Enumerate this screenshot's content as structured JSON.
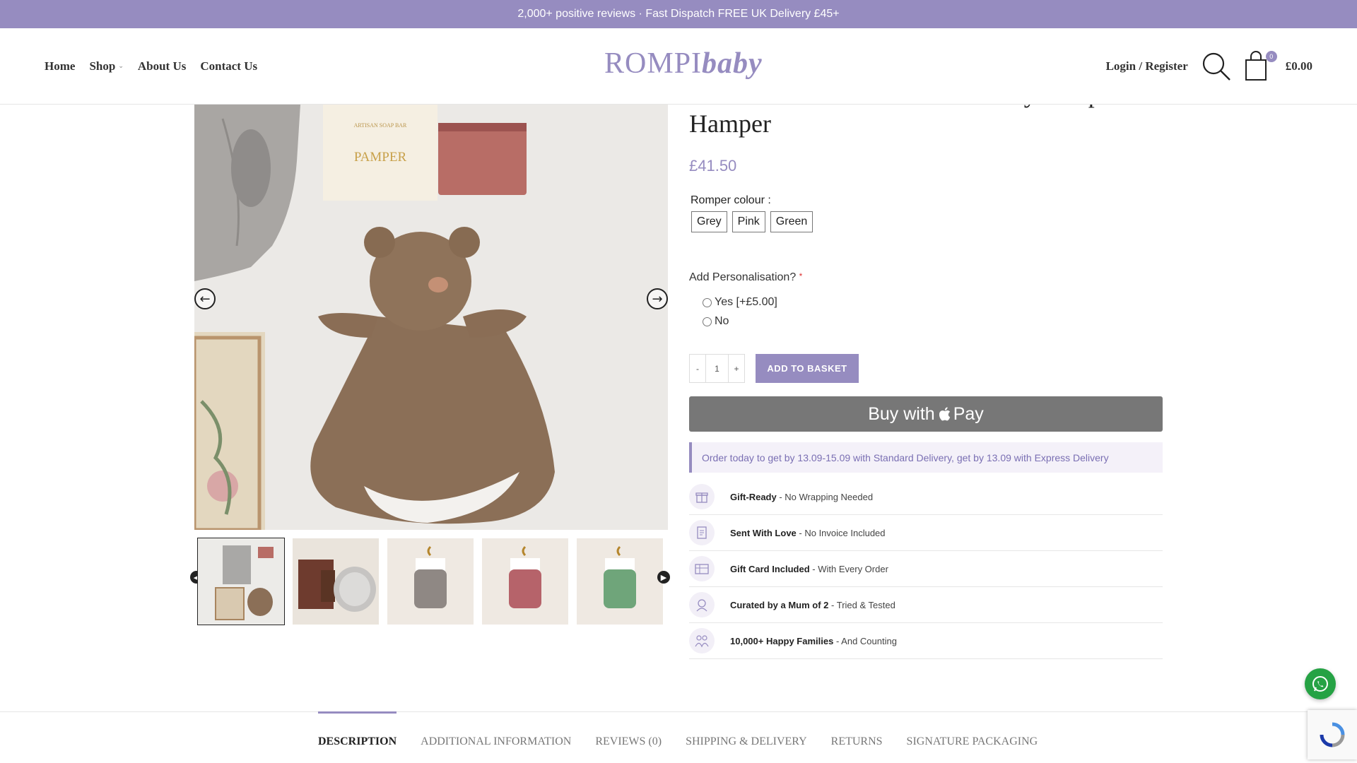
{
  "topbar": {
    "text": "2,000+ positive reviews · Fast Dispatch FREE UK Delivery £45+"
  },
  "header": {
    "nav": [
      {
        "label": "Home"
      },
      {
        "label": "Shop"
      },
      {
        "label": "About Us"
      },
      {
        "label": "Contact Us"
      }
    ],
    "logo": {
      "part1": "ROMPI",
      "part2": "baby"
    },
    "login_label": "Login / Register",
    "cart_count": "0",
    "cart_total": "£0.00"
  },
  "product": {
    "title": "You Got This! New Mum & Baby Pamper Hamper",
    "price": "£41.50",
    "colour_label": "Romper colour :",
    "colours": [
      "Grey",
      "Pink",
      "Green"
    ],
    "personalisation_label": "Add Personalisation?",
    "personalisation_required": "*",
    "personalisation_options": [
      "Yes [+£5.00]",
      "No"
    ],
    "qty_minus": "-",
    "qty_value": "1",
    "qty_plus": "+",
    "add_to_basket": "ADD TO BASKET",
    "applepay_text": "Buy with",
    "applepay_pay": "Pay",
    "delivery_note": "Order today to get by 13.09-15.09 with Standard Delivery, get by 13.09 with Express Delivery",
    "gallery_image_text": {
      "box_line1": "ARTISAN SOAP BAR",
      "box_line2": "PAMPER"
    },
    "features": [
      {
        "icon": "gift-icon",
        "bold": "Gift-Ready",
        "text": " - No Wrapping Needed"
      },
      {
        "icon": "document-icon",
        "bold": "Sent With Love",
        "text": " - No Invoice Included"
      },
      {
        "icon": "gift-card-icon",
        "bold": "Gift Card Included",
        "text": " - With Every Order"
      },
      {
        "icon": "mum-icon",
        "bold": "Curated by a Mum of 2",
        "text": " - Tried & Tested"
      },
      {
        "icon": "family-icon",
        "bold": "10,000+ Happy Families",
        "text": " - And Counting"
      }
    ]
  },
  "tabs": [
    {
      "label": "DESCRIPTION"
    },
    {
      "label": "ADDITIONAL INFORMATION"
    },
    {
      "label": "REVIEWS (0)"
    },
    {
      "label": "SHIPPING & DELIVERY"
    },
    {
      "label": "RETURNS"
    },
    {
      "label": "SIGNATURE PACKAGING"
    }
  ],
  "colors": {
    "accent": "#968cc0",
    "whatsapp": "#25a244"
  }
}
